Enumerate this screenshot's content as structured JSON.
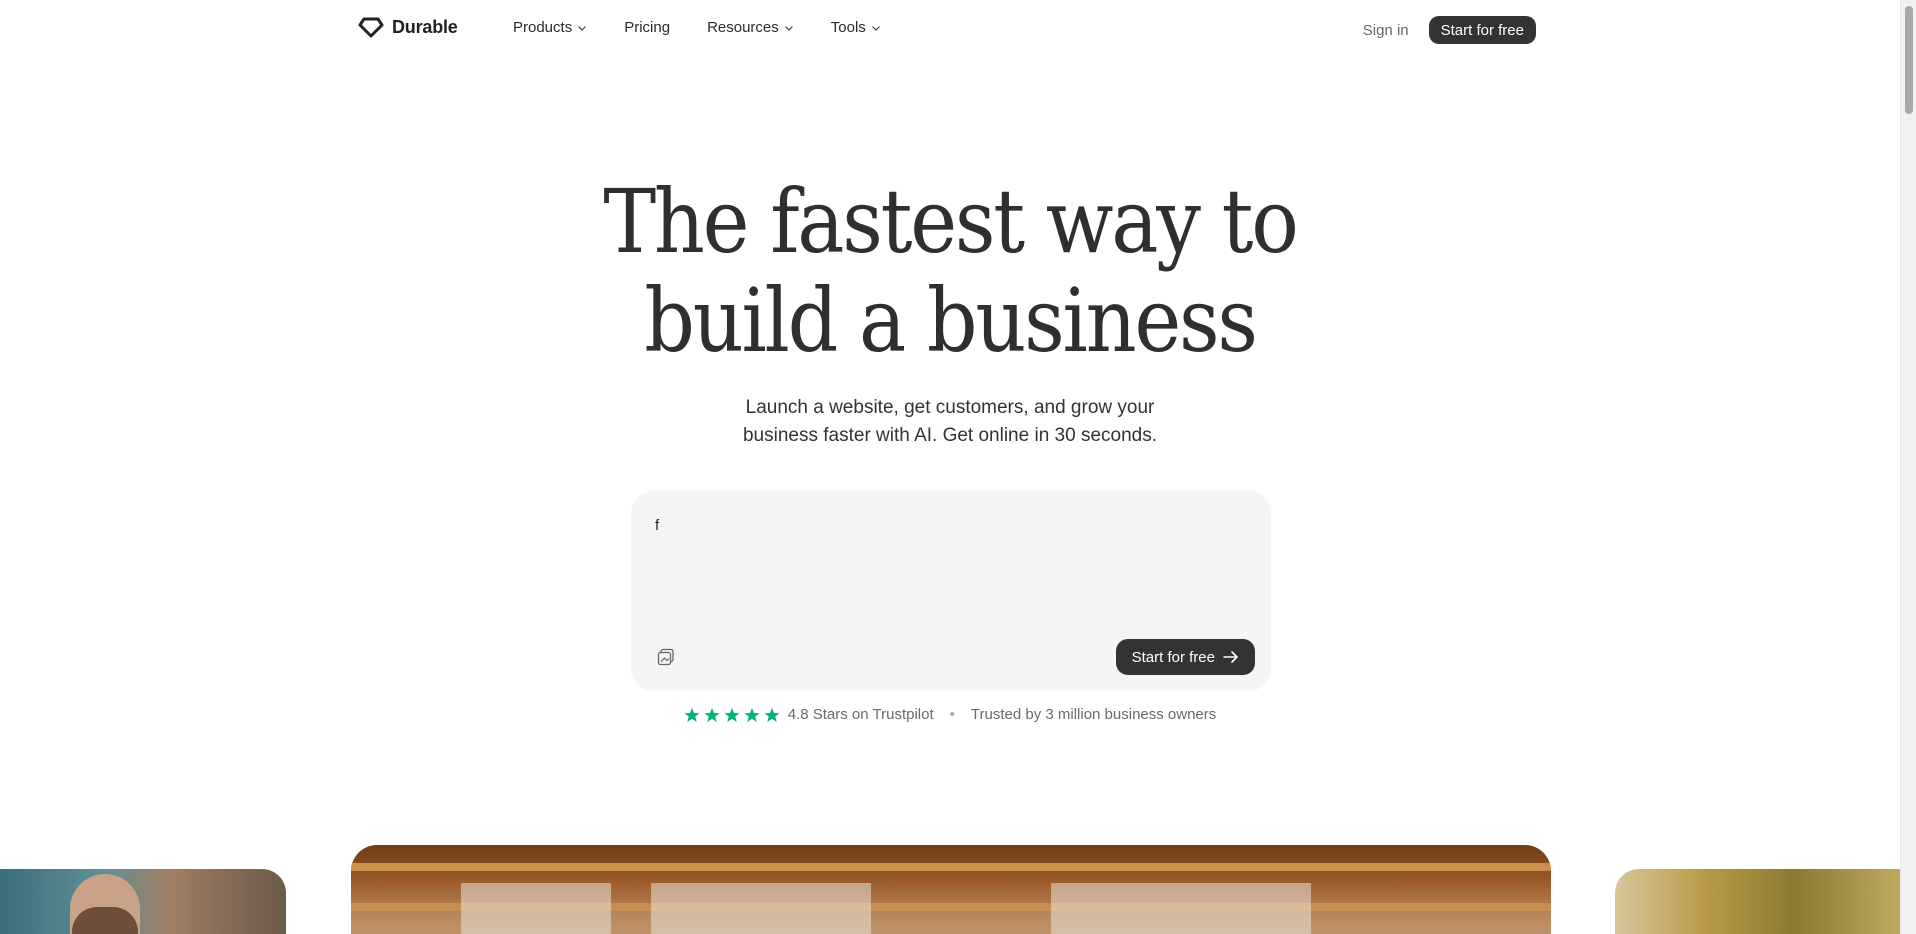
{
  "brand": {
    "name": "Durable",
    "icon": "diamond-logo"
  },
  "nav": {
    "items": [
      {
        "label": "Products",
        "dropdown": true
      },
      {
        "label": "Pricing",
        "dropdown": false
      },
      {
        "label": "Resources",
        "dropdown": true
      },
      {
        "label": "Tools",
        "dropdown": true
      }
    ],
    "sign_in": "Sign in",
    "cta": "Start for free"
  },
  "hero": {
    "title_line1": "The fastest way to",
    "title_line2": "build a business",
    "subtitle_line1": "Launch a website, get customers, and grow your",
    "subtitle_line2": "business faster with AI. Get online in 30 seconds."
  },
  "prompt": {
    "value": "f",
    "attach_icon": "image-icon",
    "submit_label": "Start for free",
    "submit_icon": "arrow-right-icon"
  },
  "trust": {
    "stars": 5,
    "rating_text": "4.8 Stars on Trustpilot",
    "separator": "•",
    "trusted_text": "Trusted by 3 million business owners"
  },
  "colors": {
    "dark_button": "#333333",
    "star_green": "#00b67a",
    "prompt_bg": "#f5f5f5"
  }
}
